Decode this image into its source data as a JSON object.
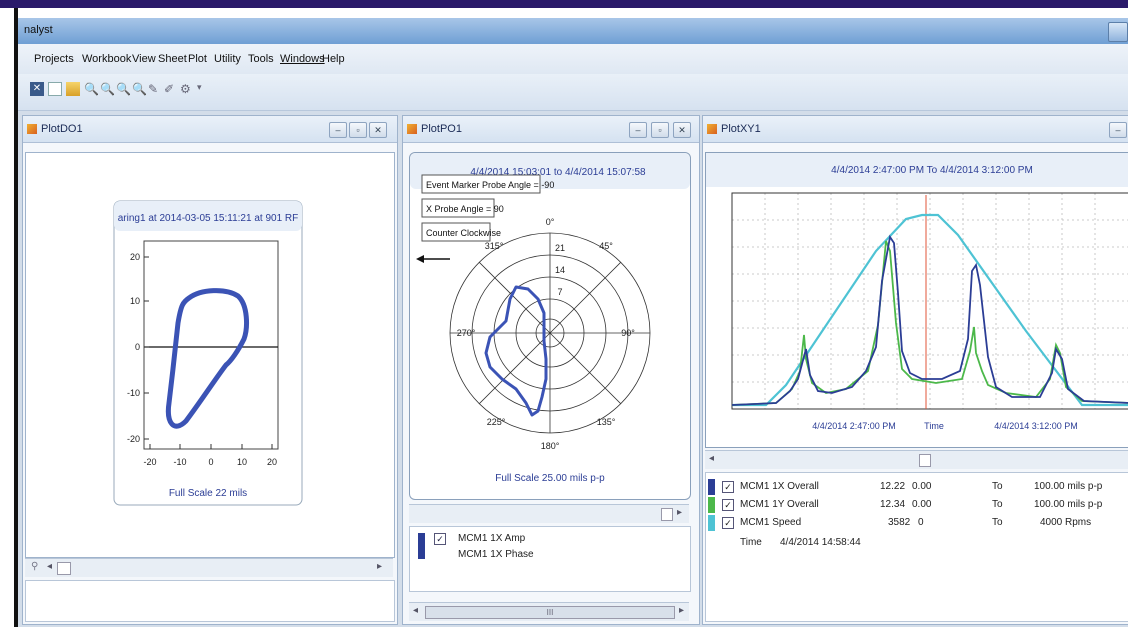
{
  "window": {
    "title": "nalyst"
  },
  "menu": [
    "Projects",
    "Workbook",
    "View",
    "Sheet",
    "Plot",
    "Utility",
    "Tools",
    "Windows",
    "Help"
  ],
  "toolbar": {
    "icons": [
      "close-icon",
      "new-icon",
      "open-icon",
      "zoom-in-icon",
      "zoom-out-icon",
      "zoom-fit-icon",
      "zoom-reset-icon",
      "pen-icon",
      "marker-icon",
      "settings-icon",
      "dropdown-arrow-icon"
    ]
  },
  "plot_do": {
    "title": "PlotDO1",
    "chart_title": "aring1 at 2014-03-05 15:11:21 at 901 RF",
    "yticks": [
      "20",
      "10",
      "0",
      "-10",
      "-20"
    ],
    "xticks": [
      "-20",
      "-10",
      "0",
      "10",
      "20"
    ],
    "footer": "Full Scale 22 mils"
  },
  "plot_po": {
    "title": "PlotPO1",
    "range": "4/4/2014 15:03:01 to 4/4/2014 15:07:58",
    "notes": [
      "Event Marker Probe Angle = -90",
      "X Probe Angle = 90",
      "Counter Clockwise"
    ],
    "angles": [
      "0°",
      "45°",
      "90°",
      "135°",
      "180°",
      "225°",
      "270°",
      "315°"
    ],
    "rings": [
      "21",
      "14",
      "7"
    ],
    "footer": "Full Scale 25.00 mils p-p",
    "legend": [
      "MCM1 1X Amp",
      "MCM1 1X Phase"
    ],
    "scroll_label": "III"
  },
  "plot_xy": {
    "title": "PlotXY1",
    "range": "4/4/2014 2:47:00 PM To 4/4/2014 3:12:00 PM",
    "x_left": "4/4/2014 2:47:00 PM",
    "x_mid": "Time",
    "x_right": "4/4/2014 3:12:00 PM",
    "colors": {
      "mcm1x": "#2b3d95",
      "mcm1y": "#4cb84a",
      "speed": "#4ec3d4",
      "marker": "#e0553a"
    },
    "table": [
      {
        "name": "MCM1 1X Overall",
        "v1": "12.22",
        "v2": "0.00",
        "to": "To",
        "max": "100.00 mils p-p"
      },
      {
        "name": "MCM1 1Y Overall",
        "v1": "12.34",
        "v2": "0.00",
        "to": "To",
        "max": "100.00 mils p-p"
      },
      {
        "name": "MCM1 Speed",
        "v1": "3582",
        "v2": "0",
        "to": "To",
        "max": "4000 Rpms"
      }
    ],
    "time_label": "Time",
    "time_value": "4/4/2014 14:58:44"
  }
}
